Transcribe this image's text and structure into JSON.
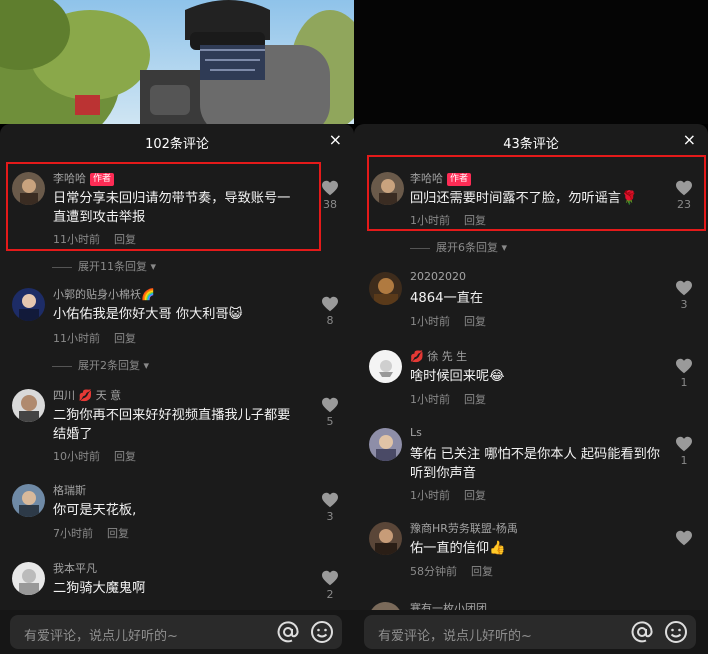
{
  "left": {
    "title": "102条评论",
    "close": "×",
    "author_tag": "作者",
    "comments": [
      {
        "user": "李哈哈",
        "text": "日常分享未回归请勿带节奏，导致账号一直遭到攻击举报",
        "time": "11小时前",
        "reply": "回复",
        "likes": "38"
      },
      {
        "user": "小郭的贴身小棉袄🌈",
        "text": "小佑佑我是你好大哥 你大利哥😺",
        "time": "11小时前",
        "reply": "回复",
        "likes": "8"
      },
      {
        "user": "四川 💋 天 意",
        "text": "二狗你再不回来好好视频直播我儿子都要结婚了",
        "time": "10小时前",
        "reply": "回复",
        "likes": "5"
      },
      {
        "user": "格瑞斯",
        "text": "你可是天花板,",
        "time": "7小时前",
        "reply": "回复",
        "likes": "3"
      },
      {
        "user": "我本平凡",
        "text": "二狗骑大魔鬼啊",
        "time": "",
        "reply": "",
        "likes": "2"
      }
    ],
    "expands": [
      "展开11条回复",
      "展开2条回复"
    ],
    "input_placeholder": "有爱评论，说点儿好听的~"
  },
  "right": {
    "title": "43条评论",
    "close": "×",
    "author_tag": "作者",
    "comments": [
      {
        "user": "李哈哈",
        "text": "回归还需要时间露不了脸，勿听谣言🌹",
        "time": "1小时前",
        "reply": "回复",
        "likes": "23"
      },
      {
        "user": "20202020",
        "text": "4864一直在",
        "time": "1小时前",
        "reply": "回复",
        "likes": "3"
      },
      {
        "user": "💋 徐 先 生",
        "text": "啥时候回来呢😂",
        "time": "1小时前",
        "reply": "回复",
        "likes": "1"
      },
      {
        "user": "Ls",
        "text": "等佑 已关注 哪怕不是你本人 起码能看到你 听到你声音",
        "time": "1小时前",
        "reply": "回复",
        "likes": "1"
      },
      {
        "user": "豫商HR劳务联盟-杨禹",
        "text": "佑一直的信仰👍",
        "time": "58分钟前",
        "reply": "回复",
        "likes": ""
      },
      {
        "user": "寒有一枚小团团",
        "text": "",
        "time": "",
        "reply": "",
        "likes": ""
      }
    ],
    "expands": [
      "展开6条回复"
    ],
    "input_placeholder": "有爱评论，说点儿好听的~"
  },
  "icons": {
    "like": "heart-icon",
    "mention": "at-icon",
    "emoji": "smiley-icon",
    "close": "close-icon",
    "expand": "chevron-down-icon"
  },
  "colors": {
    "author_tag": "#fe2c55",
    "highlight": "#e41a1a",
    "sheet": "#1b1b1b"
  }
}
